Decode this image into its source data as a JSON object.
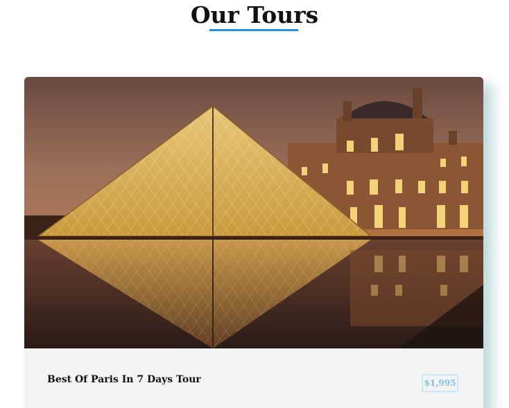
{
  "section": {
    "title": "Our Tours"
  },
  "tour_card": {
    "image_subject": "louvre-pyramid-photo",
    "name": "Best Of Paris In 7 Days Tour",
    "price": "$1,995"
  },
  "colors": {
    "accent_underline": "#1e90e8",
    "price_text": "#7cc3e0",
    "price_border": "#cfe8f5",
    "card_footer_bg": "#f3f3f3"
  }
}
